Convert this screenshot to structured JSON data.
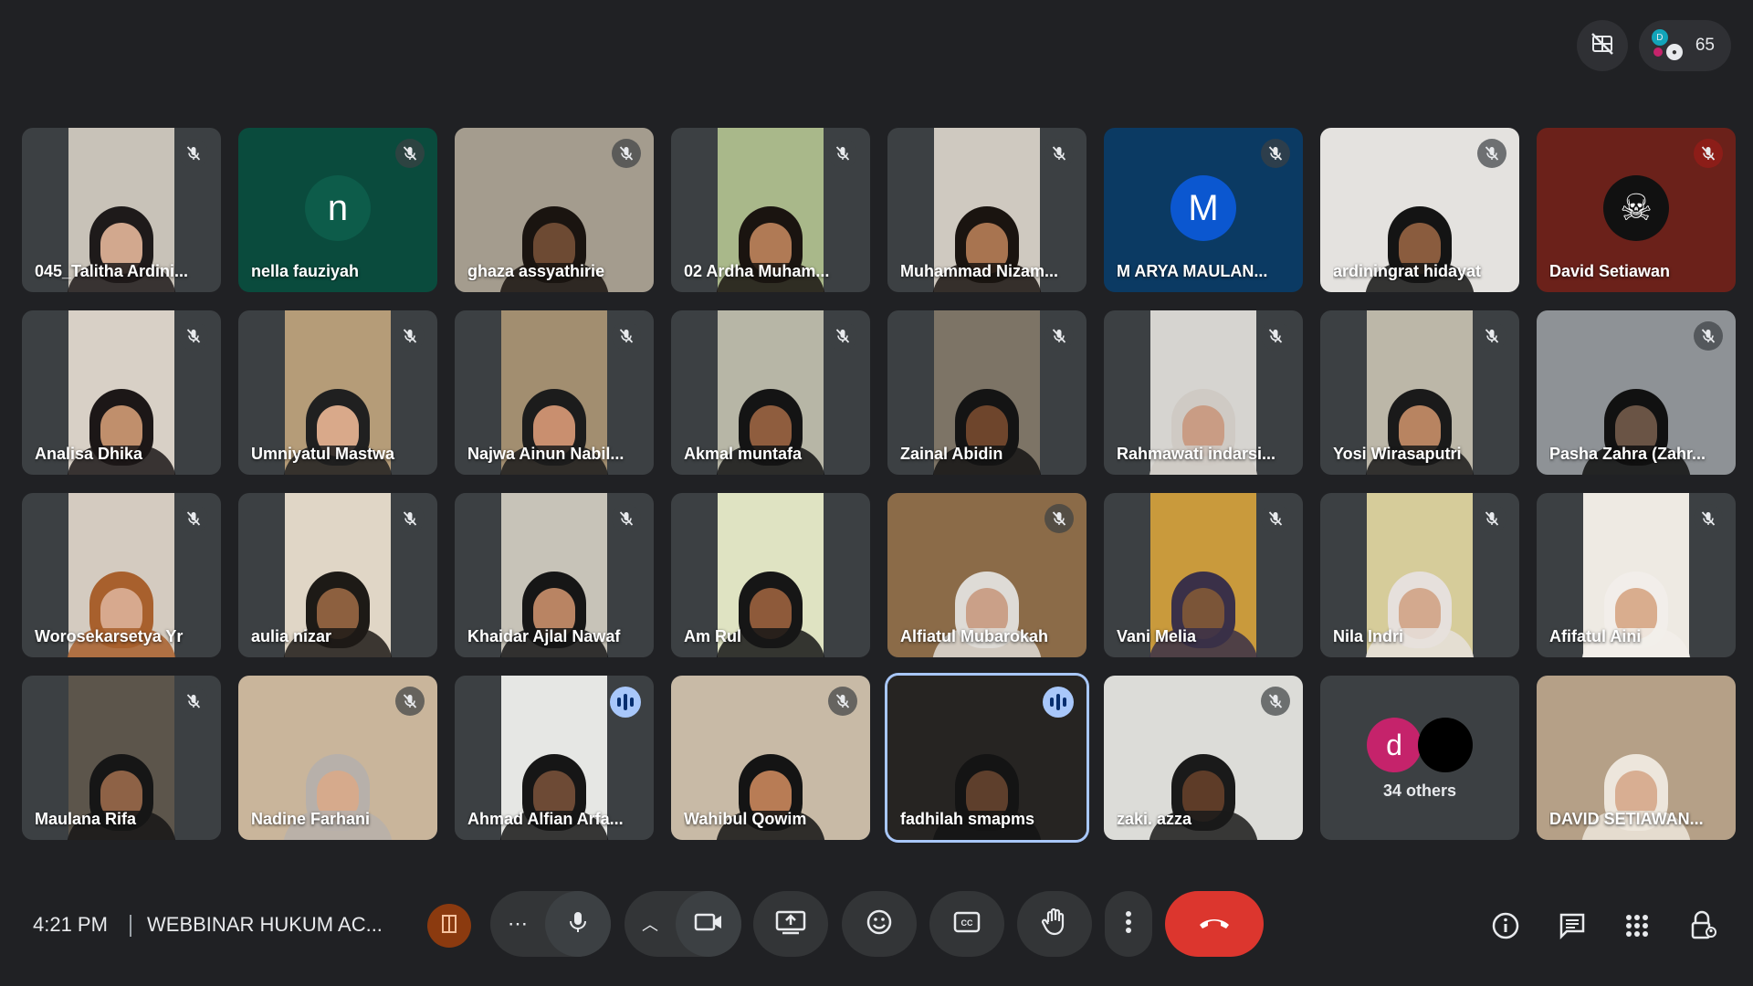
{
  "participant_count": "65",
  "meeting": {
    "time": "4:21 PM",
    "title": "WEBBINAR HUKUM AC..."
  },
  "others": {
    "label": "34 others",
    "avatar_letter": "d",
    "avatar_color": "#c5236b"
  },
  "tiles": [
    {
      "name": "045_Talitha Ardini...",
      "type": "video",
      "bg": "#c8c2b8",
      "skin": "#d2a88e",
      "hair": "#1e1a1a",
      "mic": "muted"
    },
    {
      "name": "nella fauziyah",
      "type": "avatar",
      "letter": "n",
      "bg": "#0a4b3d",
      "avatar_bg": "#0d5c4a",
      "mic": "muted"
    },
    {
      "name": "ghaza assyathirie",
      "type": "video",
      "wide": true,
      "bg": "#a49c8e",
      "skin": "#6d4a33",
      "hair": "#1a1410",
      "mic": "muted"
    },
    {
      "name": "02 Ardha Muham...",
      "type": "video",
      "bg": "#a9b88a",
      "skin": "#b07a55",
      "hair": "#1a1410",
      "mic": "muted"
    },
    {
      "name": "Muhammad Nizam...",
      "type": "video",
      "bg": "#cfc9c0",
      "skin": "#a87450",
      "hair": "#1a1410",
      "mic": "muted"
    },
    {
      "name": "M ARYA MAULAN...",
      "type": "avatar",
      "letter": "M",
      "bg": "#0b3a63",
      "avatar_bg": "#0b57d0",
      "mic": "muted"
    },
    {
      "name": "ardiningrat hidayat",
      "type": "video",
      "wide": true,
      "bg": "#e4e2df",
      "skin": "#8a5c3e",
      "hair": "#141414",
      "mic": "muted"
    },
    {
      "name": "David Setiawan",
      "type": "avatar",
      "letter": "☠",
      "bg": "#6b211a",
      "avatar_bg": "#111111",
      "mic": "muted_red"
    },
    {
      "name": "Analisa Dhika",
      "type": "video",
      "bg": "#d8d0c6",
      "skin": "#c08f6c",
      "hair": "#1c1717",
      "mic": "muted"
    },
    {
      "name": "Umniyatul Mastwa",
      "type": "video",
      "bg": "#b59c78",
      "skin": "#d9a98a",
      "hair": "#202020",
      "mic": "muted"
    },
    {
      "name": "Najwa Ainun Nabil...",
      "type": "video",
      "bg": "#a28e70",
      "skin": "#c98f6f",
      "hair": "#1c1c1c",
      "mic": "muted"
    },
    {
      "name": "Akmal muntafa",
      "type": "video",
      "bg": "#b7b6a6",
      "skin": "#8f5d3e",
      "hair": "#141414",
      "mic": "muted"
    },
    {
      "name": "Zainal Abidin",
      "type": "video",
      "bg": "#7d7466",
      "skin": "#6e452c",
      "hair": "#141414",
      "mic": "muted"
    },
    {
      "name": "Rahmawati indarsi...",
      "type": "video",
      "bg": "#d6d4d0",
      "skin": "#c99c84",
      "hair": "#cfcac4",
      "mic": "muted"
    },
    {
      "name": "Yosi Wirasaputri",
      "type": "video",
      "bg": "#bcb7a8",
      "skin": "#b88461",
      "hair": "#1a1a1a",
      "mic": "muted"
    },
    {
      "name": "Pasha Zahra (Zahr...",
      "type": "video",
      "wide": true,
      "bg": "#8e9296",
      "skin": "#6a5445",
      "hair": "#111111",
      "mic": "muted"
    },
    {
      "name": "Worosekarsetya Yr",
      "type": "video",
      "bg": "#d4cbc0",
      "skin": "#d7a98e",
      "hair": "#a8602d",
      "mic": "muted"
    },
    {
      "name": "aulia nizar",
      "type": "video",
      "bg": "#e0d6c6",
      "skin": "#8d603f",
      "hair": "#1d1a16",
      "mic": "muted"
    },
    {
      "name": "Khaidar Ajlal Nawaf",
      "type": "video",
      "bg": "#c7c3b8",
      "skin": "#b98463",
      "hair": "#161616",
      "mic": "muted"
    },
    {
      "name": "Am Rul",
      "type": "video",
      "bg": "#dfe3c2",
      "skin": "#8e5a3a",
      "hair": "#161616",
      "mic": "none"
    },
    {
      "name": "Alfiatul Mubarokah",
      "type": "video",
      "wide": true,
      "bg": "#8b6b48",
      "skin": "#caa088",
      "hair": "#dedbd6",
      "mic": "muted"
    },
    {
      "name": "Vani Melia",
      "type": "video",
      "bg": "#c99a3c",
      "skin": "#7b5538",
      "hair": "#3a3048",
      "mic": "muted"
    },
    {
      "name": "Nila Indri",
      "type": "video",
      "bg": "#d6cc9a",
      "skin": "#d3a98e",
      "hair": "#e6e0dc",
      "mic": "muted"
    },
    {
      "name": "Afifatul Aini",
      "type": "video",
      "bg": "#eeeae3",
      "skin": "#d9ad8e",
      "hair": "#f2eeea",
      "mic": "muted"
    },
    {
      "name": "Maulana Rifa",
      "type": "video",
      "bg": "#5c554b",
      "skin": "#8e6246",
      "hair": "#161616",
      "mic": "muted"
    },
    {
      "name": "Nadine Farhani",
      "type": "video",
      "wide": true,
      "bg": "#c9b59b",
      "skin": "#d6aa8c",
      "hair": "#b7b0aa",
      "mic": "muted"
    },
    {
      "name": "Ahmad Alfian Arfa...",
      "type": "video",
      "bg": "#e6e7e4",
      "skin": "#6d4a35",
      "hair": "#161616",
      "mic": "speaking"
    },
    {
      "name": "Wahibul Qowim",
      "type": "video",
      "wide": true,
      "bg": "#c8baa6",
      "skin": "#b87c55",
      "hair": "#141414",
      "mic": "muted"
    },
    {
      "name": "fadhilah smapms",
      "type": "video",
      "wide": true,
      "bg": "#262422",
      "skin": "#5e3f2c",
      "hair": "#141414",
      "mic": "speaking",
      "active": true
    },
    {
      "name": "zaki. azza",
      "type": "video",
      "wide": true,
      "bg": "#dcdcd8",
      "skin": "#5e3c28",
      "hair": "#1a1a1a",
      "mic": "muted"
    },
    {
      "type": "others"
    },
    {
      "name": "DAVID SETIAWAN...",
      "type": "video",
      "wide": true,
      "bg": "#b5a087",
      "skin": "#d8ae92",
      "hair": "#ede6dc",
      "mic": "none"
    }
  ]
}
